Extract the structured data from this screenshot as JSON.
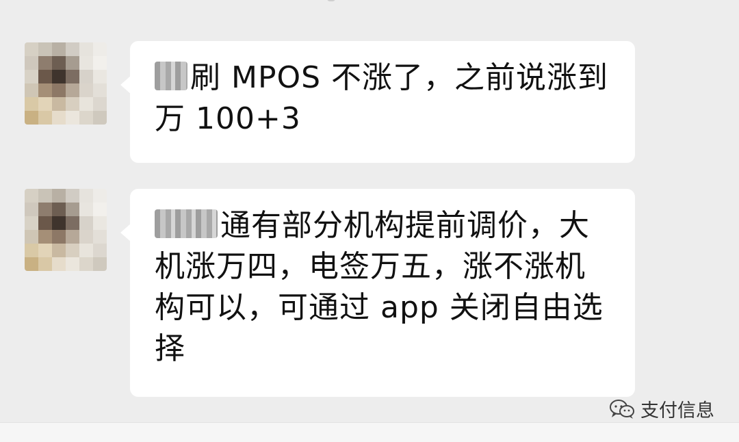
{
  "messages": [
    {
      "blurred_prefix": "",
      "text": "刷 MPOS 不涨了，之前说涨到万 100+3"
    },
    {
      "blurred_prefix": "",
      "text": "通有部分机构提前调价，大机涨万四，电签万五，涨不涨机构可以，可通过 app 关闭自由选择"
    }
  ],
  "watermark": {
    "label": "支付信息",
    "icon": "wechat-icon"
  },
  "colors": {
    "background": "#ededed",
    "bubble": "#ffffff",
    "text": "#111111"
  }
}
